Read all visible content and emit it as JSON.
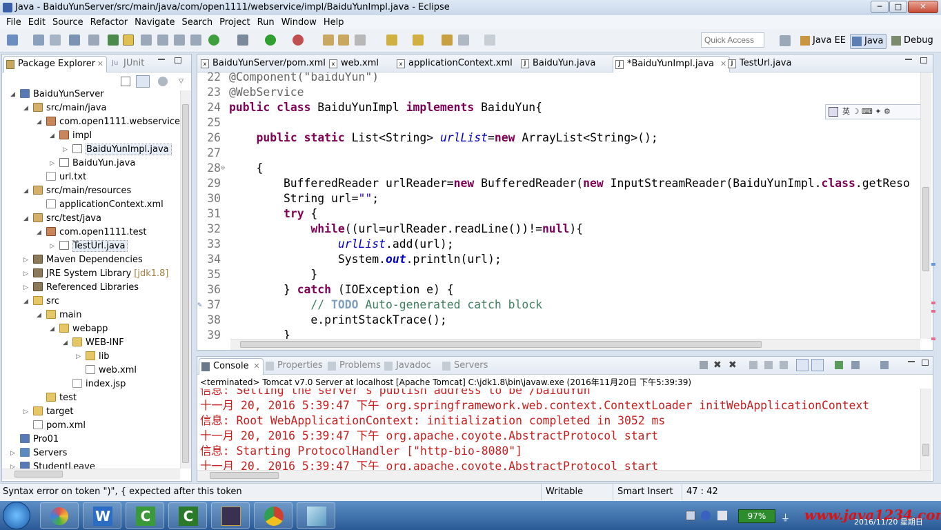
{
  "window": {
    "title": "Java - BaiduYunServer/src/main/java/com/open1111/webservice/impl/BaiduYunImpl.java - Eclipse",
    "minimize": "─",
    "maximize": "□",
    "close": "✕"
  },
  "menu": [
    "File",
    "Edit",
    "Source",
    "Refactor",
    "Navigate",
    "Search",
    "Project",
    "Run",
    "Window",
    "Help"
  ],
  "toolbar": {
    "quick_access_placeholder": "Quick Access",
    "perspectives": [
      "Java EE",
      "Java",
      "Debug"
    ]
  },
  "explorer": {
    "tabs": [
      "Package Explorer",
      "JUnit"
    ],
    "tree": [
      {
        "label": "BaiduYunServer",
        "icon": "project-icon",
        "depth": 0,
        "twisty": "◢"
      },
      {
        "label": "src/main/java",
        "icon": "source-folder-icon",
        "depth": 1,
        "twisty": "◢"
      },
      {
        "label": "com.open1111.webservice",
        "icon": "package-icon",
        "depth": 2,
        "twisty": "◢"
      },
      {
        "label": "impl",
        "icon": "package-icon",
        "depth": 3,
        "twisty": "◢"
      },
      {
        "label": "BaiduYunImpl.java",
        "icon": "java-file-icon",
        "depth": 4,
        "twisty": "▷",
        "selected": true
      },
      {
        "label": "BaiduYun.java",
        "icon": "java-file-icon",
        "depth": 3,
        "twisty": "▷"
      },
      {
        "label": "url.txt",
        "icon": "text-file-icon",
        "depth": 2,
        "twisty": ""
      },
      {
        "label": "src/main/resources",
        "icon": "source-folder-icon",
        "depth": 1,
        "twisty": "◢"
      },
      {
        "label": "applicationContext.xml",
        "icon": "xml-file-icon",
        "depth": 2,
        "twisty": ""
      },
      {
        "label": "src/test/java",
        "icon": "source-folder-icon",
        "depth": 1,
        "twisty": "◢"
      },
      {
        "label": "com.open1111.test",
        "icon": "package-icon",
        "depth": 2,
        "twisty": "◢"
      },
      {
        "label": "TestUrl.java",
        "icon": "java-file-icon",
        "depth": 3,
        "twisty": "▷",
        "selected": true
      },
      {
        "label": "Maven Dependencies",
        "icon": "library-icon",
        "depth": 1,
        "twisty": "▷"
      },
      {
        "label": "JRE System Library",
        "suffix": "[jdk1.8]",
        "icon": "library-icon",
        "depth": 1,
        "twisty": "▷"
      },
      {
        "label": "Referenced Libraries",
        "icon": "library-icon",
        "depth": 1,
        "twisty": "▷"
      },
      {
        "label": "src",
        "icon": "folder-icon",
        "depth": 1,
        "twisty": "◢"
      },
      {
        "label": "main",
        "icon": "folder-icon",
        "depth": 2,
        "twisty": "◢"
      },
      {
        "label": "webapp",
        "icon": "folder-icon",
        "depth": 3,
        "twisty": "◢"
      },
      {
        "label": "WEB-INF",
        "icon": "folder-icon",
        "depth": 4,
        "twisty": "◢"
      },
      {
        "label": "lib",
        "icon": "folder-icon",
        "depth": 5,
        "twisty": "▷"
      },
      {
        "label": "web.xml",
        "icon": "xml-file-icon",
        "depth": 5,
        "twisty": ""
      },
      {
        "label": "index.jsp",
        "icon": "jsp-file-icon",
        "depth": 4,
        "twisty": ""
      },
      {
        "label": "test",
        "icon": "folder-icon",
        "depth": 2,
        "twisty": ""
      },
      {
        "label": "target",
        "icon": "folder-icon",
        "depth": 1,
        "twisty": "▷"
      },
      {
        "label": "pom.xml",
        "icon": "xml-file-icon",
        "depth": 1,
        "twisty": ""
      },
      {
        "label": "Pro01",
        "icon": "project-icon",
        "depth": 0,
        "twisty": ""
      },
      {
        "label": "Servers",
        "icon": "servers-icon",
        "depth": 0,
        "twisty": "▷"
      },
      {
        "label": "StudentLeave",
        "icon": "project-icon",
        "depth": 0,
        "twisty": "▷"
      }
    ]
  },
  "editor": {
    "tabs": [
      {
        "label": "BaiduYunServer/pom.xml",
        "icon": "xml-file-icon"
      },
      {
        "label": "web.xml",
        "icon": "xml-file-icon"
      },
      {
        "label": "applicationContext.xml",
        "icon": "xml-file-icon"
      },
      {
        "label": "BaiduYun.java",
        "icon": "java-file-icon"
      },
      {
        "label": "*BaiduYunImpl.java",
        "icon": "java-file-icon",
        "active": true
      },
      {
        "label": "TestUrl.java",
        "icon": "java-file-icon"
      }
    ],
    "lines": [
      {
        "n": "22",
        "c": [
          [
            "an",
            "@Component(\"baiduYun\")"
          ]
        ]
      },
      {
        "n": "23",
        "c": [
          [
            "an",
            "@WebService"
          ]
        ]
      },
      {
        "n": "24",
        "c": [
          [
            "kw",
            "public"
          ],
          [
            "",
            " "
          ],
          [
            "kw",
            "class"
          ],
          [
            "",
            " BaiduYunImpl "
          ],
          [
            "kw",
            "implements"
          ],
          [
            "",
            " BaiduYun{"
          ]
        ]
      },
      {
        "n": "25",
        "c": []
      },
      {
        "n": "26",
        "c": [
          [
            "",
            "    "
          ],
          [
            "kw",
            "public"
          ],
          [
            "",
            " "
          ],
          [
            "kw",
            "static"
          ],
          [
            "",
            " List<String> "
          ],
          [
            "fi",
            "urlList"
          ],
          [
            "",
            "="
          ],
          [
            "kw",
            "new"
          ],
          [
            "",
            " ArrayList<String>();"
          ]
        ]
      },
      {
        "n": "27",
        "c": []
      },
      {
        "n": "28",
        "c": [
          [
            "",
            "    {"
          ]
        ],
        "fold": "⊖"
      },
      {
        "n": "29",
        "c": [
          [
            "",
            "        BufferedReader urlReader="
          ],
          [
            "kw",
            "new"
          ],
          [
            "",
            " BufferedReader("
          ],
          [
            "kw",
            "new"
          ],
          [
            "",
            " InputStreamReader(BaiduYunImpl."
          ],
          [
            "kw",
            "class"
          ],
          [
            "",
            ".getReso"
          ]
        ]
      },
      {
        "n": "30",
        "c": [
          [
            "",
            "        String url="
          ],
          [
            "st",
            "\"\""
          ],
          [
            "",
            ";"
          ]
        ]
      },
      {
        "n": "31",
        "c": [
          [
            "",
            "        "
          ],
          [
            "kw",
            "try"
          ],
          [
            "",
            " {"
          ]
        ]
      },
      {
        "n": "32",
        "c": [
          [
            "",
            "            "
          ],
          [
            "kw",
            "while"
          ],
          [
            "",
            "((url=urlReader.readLine())!="
          ],
          [
            "kw",
            "null"
          ],
          [
            "",
            "){"
          ]
        ]
      },
      {
        "n": "33",
        "c": [
          [
            "",
            "                "
          ],
          [
            "fi",
            "urlList"
          ],
          [
            "",
            ".add(url);"
          ]
        ]
      },
      {
        "n": "34",
        "c": [
          [
            "",
            "                System."
          ],
          [
            "sf",
            "out"
          ],
          [
            "",
            ".println(url);"
          ]
        ]
      },
      {
        "n": "35",
        "c": [
          [
            "",
            "            }"
          ]
        ]
      },
      {
        "n": "36",
        "c": [
          [
            "",
            "        } "
          ],
          [
            "kw",
            "catch"
          ],
          [
            "",
            " (IOException e) {"
          ]
        ]
      },
      {
        "n": "37",
        "c": [
          [
            "",
            "            "
          ],
          [
            "cm",
            "// "
          ],
          [
            "td",
            "TODO"
          ],
          [
            "cm",
            " Auto-generated catch block"
          ]
        ],
        "marker": "✎"
      },
      {
        "n": "38",
        "c": [
          [
            "",
            "            e.printStackTrace();"
          ]
        ]
      },
      {
        "n": "39",
        "c": [
          [
            "",
            "        }"
          ]
        ]
      }
    ],
    "ime_toolbar": "英 ☽ ⌨ ✦ ⚙"
  },
  "console": {
    "tabs": [
      "Console",
      "Properties",
      "Problems",
      "Javadoc",
      "Servers"
    ],
    "status": "<terminated> Tomcat v7.0 Server at localhost [Apache Tomcat] C:\\jdk1.8\\bin\\javaw.exe (2016年11月20日 下午5:39:39)",
    "output": [
      "信息: Setting the server's publish address to be /baiduYun",
      "十一月 20, 2016 5:39:47 下午 org.springframework.web.context.ContextLoader initWebApplicationContext",
      "信息: Root WebApplicationContext: initialization completed in 3052 ms",
      "十一月 20, 2016 5:39:47 下午 org.apache.coyote.AbstractProtocol start",
      "信息: Starting ProtocolHandler [\"http-bio-8080\"]",
      "十一月 20, 2016 5:39:47 下午 org.apache.coyote.AbstractProtocol start"
    ]
  },
  "statusbar": {
    "message": "Syntax error on token \")\", { expected after this token",
    "mode": "Writable",
    "insert": "Smart Insert",
    "position": "47 : 42"
  },
  "taskbar": {
    "battery": "97%",
    "watermark": "www.java1234.com",
    "date": "2016/11/20 星期日"
  },
  "colors": {
    "keyword": "#7f0055",
    "annotation": "#646464",
    "string": "#2a00ff",
    "field": "#0000c0",
    "comment": "#3f7f5f",
    "console_error": "#c81e1e"
  }
}
